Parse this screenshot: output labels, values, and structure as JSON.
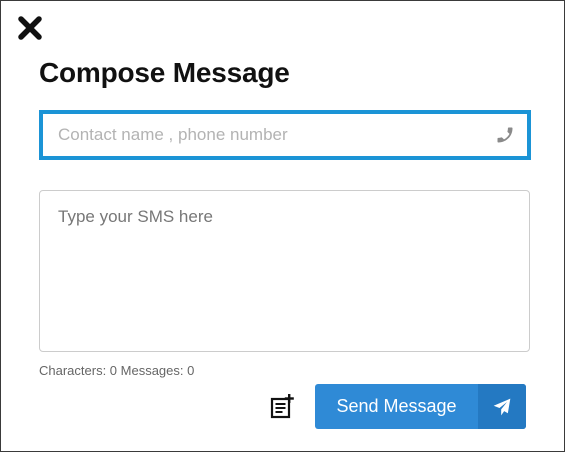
{
  "dialog": {
    "title": "Compose Message",
    "close_icon": "close-icon"
  },
  "contact": {
    "placeholder": "Contact name , phone number",
    "value": "",
    "icon": "phone-icon",
    "accent_color": "#1b94d6"
  },
  "message": {
    "placeholder": "Type your SMS here",
    "value": ""
  },
  "counter": {
    "text": "Characters: 0 Messages: 0"
  },
  "actions": {
    "template_icon": "add-note-icon",
    "send_label": "Send Message",
    "send_icon": "paper-plane-icon",
    "button_color": "#2f8ad6"
  }
}
